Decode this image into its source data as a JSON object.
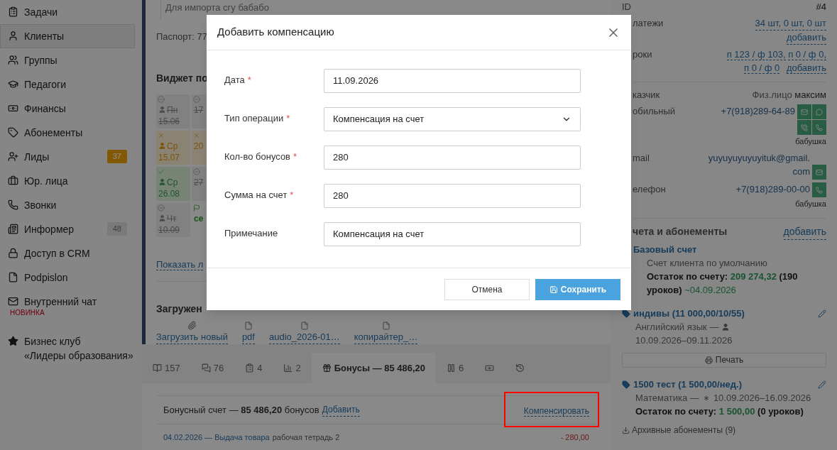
{
  "sidebar": {
    "items": [
      {
        "label": "Задачи",
        "selected": false
      },
      {
        "label": "Клиенты",
        "selected": true
      },
      {
        "label": "Группы",
        "selected": false
      },
      {
        "label": "Педагоги",
        "selected": false
      },
      {
        "label": "Финансы",
        "selected": false
      },
      {
        "label": "Абонементы",
        "selected": false
      },
      {
        "label": "Лиды",
        "selected": false,
        "badge": {
          "text": "37",
          "kind": "warning"
        }
      },
      {
        "label": "Юр. лица",
        "selected": false
      },
      {
        "label": "Звонки",
        "selected": false
      },
      {
        "label": "Информер",
        "selected": false,
        "badge": {
          "text": "48",
          "kind": "muted"
        }
      },
      {
        "label": "Доступ в CRM",
        "selected": false
      },
      {
        "label": "Podpislon",
        "selected": false
      },
      {
        "label": "Внутренний чат",
        "selected": false,
        "note": "НОВИНКА"
      },
      {
        "label": "Бизнес клуб\n«Лидеры образования»",
        "selected": false
      }
    ]
  },
  "client_card": {
    "comment": "Для импорта сгу бабабо",
    "passport": "Паспорт: 77",
    "widget_title": "Виджет по",
    "tiles": [
      {
        "kind": "cancelled",
        "day": "Пн",
        "date": "15.06"
      },
      {
        "kind": "cancelled",
        "date": "17"
      },
      {
        "kind": "missed",
        "day": "Ср",
        "date": "15.07"
      },
      {
        "kind": "missed",
        "date": "20"
      },
      {
        "kind": "attended",
        "day": "Ср",
        "date": "26.08"
      },
      {
        "kind": "cancelled",
        "date": "27"
      },
      {
        "kind": "cancelled",
        "day": "Чт",
        "date": "10.09"
      },
      {
        "kind": "planned",
        "date": "се"
      }
    ],
    "show_more": "Показать л",
    "files_title": "Загружен",
    "files": [
      {
        "kind": "upload",
        "name": "Загрузить новый"
      },
      {
        "kind": "file",
        "name": "pdf"
      },
      {
        "kind": "file",
        "name": "audio_2026-01…"
      },
      {
        "kind": "file",
        "name": "копирайтер_…"
      }
    ]
  },
  "tabs": [
    {
      "kind": "lessons",
      "label": "157",
      "selected": false
    },
    {
      "kind": "comments",
      "label": "76",
      "selected": false
    },
    {
      "kind": "tasks",
      "label": "4",
      "selected": false
    },
    {
      "kind": "stats",
      "label": "2",
      "selected": false
    },
    {
      "kind": "bonus",
      "label": "Бонусы — 85 486,20",
      "selected": true
    },
    {
      "kind": "pause",
      "label": "6",
      "selected": false
    },
    {
      "kind": "money",
      "selected": false
    },
    {
      "kind": "history",
      "selected": false
    }
  ],
  "bonus_panel": {
    "summary": "Бонусный счет — **85 486,20** бонусов",
    "add": "Добавить",
    "compensate": {
      "label": "Компенсировать",
      "highlighted": true
    },
    "transactions": [
      {
        "link": "04.02.2026 — Выдача товара",
        "description": "рабочая тетрадь 2",
        "amount": "- 280,00"
      }
    ]
  },
  "client_panel": {
    "id": {
      "label": "ID",
      "value": "#4"
    },
    "payments": {
      "label": "латежи",
      "value": "34 шт, 0 шт, 0 шт",
      "action": "добавить"
    },
    "lessons": {
      "label": "роки",
      "values": [
        "п 123 / ф 103,",
        "п 0 / ф 0,",
        "п 0 / ф 0"
      ],
      "action": "добавить"
    },
    "customer": {
      "label": "казчик",
      "type": "Физ.лицо",
      "name": "максим"
    },
    "contacts": [
      {
        "kind": "mobile",
        "label": "обильный",
        "value": "+7(918)289-64-89",
        "note": "бабушка"
      },
      {
        "kind": "email",
        "label": "mail",
        "value": "yuyuyuyuyuyituk@gmail.com"
      },
      {
        "kind": "phone",
        "label": "елефон",
        "value": "+7(918)289-00-00",
        "note": "бабушка"
      }
    ],
    "accounts": {
      "heading": "чета и абонементы",
      "action": "добавить",
      "items": [
        {
          "kind": "account",
          "title": "Базовый счет",
          "description": "Счет клиента по умолчанию",
          "balance": {
            "label": "Остаток по счету:",
            "amount": "209 274,32",
            "lessons": "(190 уроков)",
            "until": "~04.09.2026"
          }
        },
        {
          "kind": "subscription",
          "title": "индивы (11 000,00/10/55)",
          "subject": "Английский язык —",
          "teacher_assigned": true,
          "dates": "10.09.2026–09.11.2026",
          "print": "Печать"
        },
        {
          "kind": "subscription",
          "title": "1500 тест (1 500,00/нед.)",
          "subject": "Математика —",
          "teacher_assigned": false,
          "dates": "10.09.2026–16.09.2026",
          "balance": {
            "label": "Остаток по счету:",
            "amount": "1 500,00",
            "lessons": "(0 уроков)"
          }
        }
      ],
      "archived": "Архивные абонементы (9)"
    }
  },
  "dialog": {
    "title": "Добавить компенсацию",
    "fields": [
      {
        "kind": "text",
        "label": "Дата",
        "required_mark": "*",
        "value": "11.09.2026"
      },
      {
        "kind": "select",
        "label": "Тип операции",
        "required_mark": "*",
        "value": "Компенсация на счет"
      },
      {
        "kind": "text",
        "label": "Кол-во бонусов",
        "required_mark": "*",
        "value": "280"
      },
      {
        "kind": "text",
        "label": "Сумма на счет",
        "required_mark": "*",
        "value": "280"
      },
      {
        "kind": "text",
        "label": "Примечание",
        "value": "Компенсация на счет"
      }
    ],
    "cancel": "Отмена",
    "save": "Сохранить"
  }
}
